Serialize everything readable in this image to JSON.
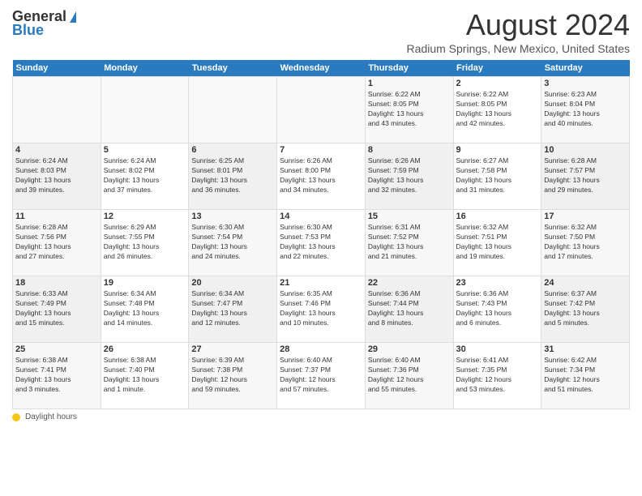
{
  "header": {
    "logo_general": "General",
    "logo_blue": "Blue",
    "title": "August 2024",
    "location": "Radium Springs, New Mexico, United States"
  },
  "calendar": {
    "days_of_week": [
      "Sunday",
      "Monday",
      "Tuesday",
      "Wednesday",
      "Thursday",
      "Friday",
      "Saturday"
    ],
    "weeks": [
      [
        {
          "day": "",
          "info": ""
        },
        {
          "day": "",
          "info": ""
        },
        {
          "day": "",
          "info": ""
        },
        {
          "day": "",
          "info": ""
        },
        {
          "day": "1",
          "info": "Sunrise: 6:22 AM\nSunset: 8:05 PM\nDaylight: 13 hours\nand 43 minutes."
        },
        {
          "day": "2",
          "info": "Sunrise: 6:22 AM\nSunset: 8:05 PM\nDaylight: 13 hours\nand 42 minutes."
        },
        {
          "day": "3",
          "info": "Sunrise: 6:23 AM\nSunset: 8:04 PM\nDaylight: 13 hours\nand 40 minutes."
        }
      ],
      [
        {
          "day": "4",
          "info": "Sunrise: 6:24 AM\nSunset: 8:03 PM\nDaylight: 13 hours\nand 39 minutes."
        },
        {
          "day": "5",
          "info": "Sunrise: 6:24 AM\nSunset: 8:02 PM\nDaylight: 13 hours\nand 37 minutes."
        },
        {
          "day": "6",
          "info": "Sunrise: 6:25 AM\nSunset: 8:01 PM\nDaylight: 13 hours\nand 36 minutes."
        },
        {
          "day": "7",
          "info": "Sunrise: 6:26 AM\nSunset: 8:00 PM\nDaylight: 13 hours\nand 34 minutes."
        },
        {
          "day": "8",
          "info": "Sunrise: 6:26 AM\nSunset: 7:59 PM\nDaylight: 13 hours\nand 32 minutes."
        },
        {
          "day": "9",
          "info": "Sunrise: 6:27 AM\nSunset: 7:58 PM\nDaylight: 13 hours\nand 31 minutes."
        },
        {
          "day": "10",
          "info": "Sunrise: 6:28 AM\nSunset: 7:57 PM\nDaylight: 13 hours\nand 29 minutes."
        }
      ],
      [
        {
          "day": "11",
          "info": "Sunrise: 6:28 AM\nSunset: 7:56 PM\nDaylight: 13 hours\nand 27 minutes."
        },
        {
          "day": "12",
          "info": "Sunrise: 6:29 AM\nSunset: 7:55 PM\nDaylight: 13 hours\nand 26 minutes."
        },
        {
          "day": "13",
          "info": "Sunrise: 6:30 AM\nSunset: 7:54 PM\nDaylight: 13 hours\nand 24 minutes."
        },
        {
          "day": "14",
          "info": "Sunrise: 6:30 AM\nSunset: 7:53 PM\nDaylight: 13 hours\nand 22 minutes."
        },
        {
          "day": "15",
          "info": "Sunrise: 6:31 AM\nSunset: 7:52 PM\nDaylight: 13 hours\nand 21 minutes."
        },
        {
          "day": "16",
          "info": "Sunrise: 6:32 AM\nSunset: 7:51 PM\nDaylight: 13 hours\nand 19 minutes."
        },
        {
          "day": "17",
          "info": "Sunrise: 6:32 AM\nSunset: 7:50 PM\nDaylight: 13 hours\nand 17 minutes."
        }
      ],
      [
        {
          "day": "18",
          "info": "Sunrise: 6:33 AM\nSunset: 7:49 PM\nDaylight: 13 hours\nand 15 minutes."
        },
        {
          "day": "19",
          "info": "Sunrise: 6:34 AM\nSunset: 7:48 PM\nDaylight: 13 hours\nand 14 minutes."
        },
        {
          "day": "20",
          "info": "Sunrise: 6:34 AM\nSunset: 7:47 PM\nDaylight: 13 hours\nand 12 minutes."
        },
        {
          "day": "21",
          "info": "Sunrise: 6:35 AM\nSunset: 7:46 PM\nDaylight: 13 hours\nand 10 minutes."
        },
        {
          "day": "22",
          "info": "Sunrise: 6:36 AM\nSunset: 7:44 PM\nDaylight: 13 hours\nand 8 minutes."
        },
        {
          "day": "23",
          "info": "Sunrise: 6:36 AM\nSunset: 7:43 PM\nDaylight: 13 hours\nand 6 minutes."
        },
        {
          "day": "24",
          "info": "Sunrise: 6:37 AM\nSunset: 7:42 PM\nDaylight: 13 hours\nand 5 minutes."
        }
      ],
      [
        {
          "day": "25",
          "info": "Sunrise: 6:38 AM\nSunset: 7:41 PM\nDaylight: 13 hours\nand 3 minutes."
        },
        {
          "day": "26",
          "info": "Sunrise: 6:38 AM\nSunset: 7:40 PM\nDaylight: 13 hours\nand 1 minute."
        },
        {
          "day": "27",
          "info": "Sunrise: 6:39 AM\nSunset: 7:38 PM\nDaylight: 12 hours\nand 59 minutes."
        },
        {
          "day": "28",
          "info": "Sunrise: 6:40 AM\nSunset: 7:37 PM\nDaylight: 12 hours\nand 57 minutes."
        },
        {
          "day": "29",
          "info": "Sunrise: 6:40 AM\nSunset: 7:36 PM\nDaylight: 12 hours\nand 55 minutes."
        },
        {
          "day": "30",
          "info": "Sunrise: 6:41 AM\nSunset: 7:35 PM\nDaylight: 12 hours\nand 53 minutes."
        },
        {
          "day": "31",
          "info": "Sunrise: 6:42 AM\nSunset: 7:34 PM\nDaylight: 12 hours\nand 51 minutes."
        }
      ]
    ]
  },
  "legend": {
    "daylight_hours": "Daylight hours"
  }
}
